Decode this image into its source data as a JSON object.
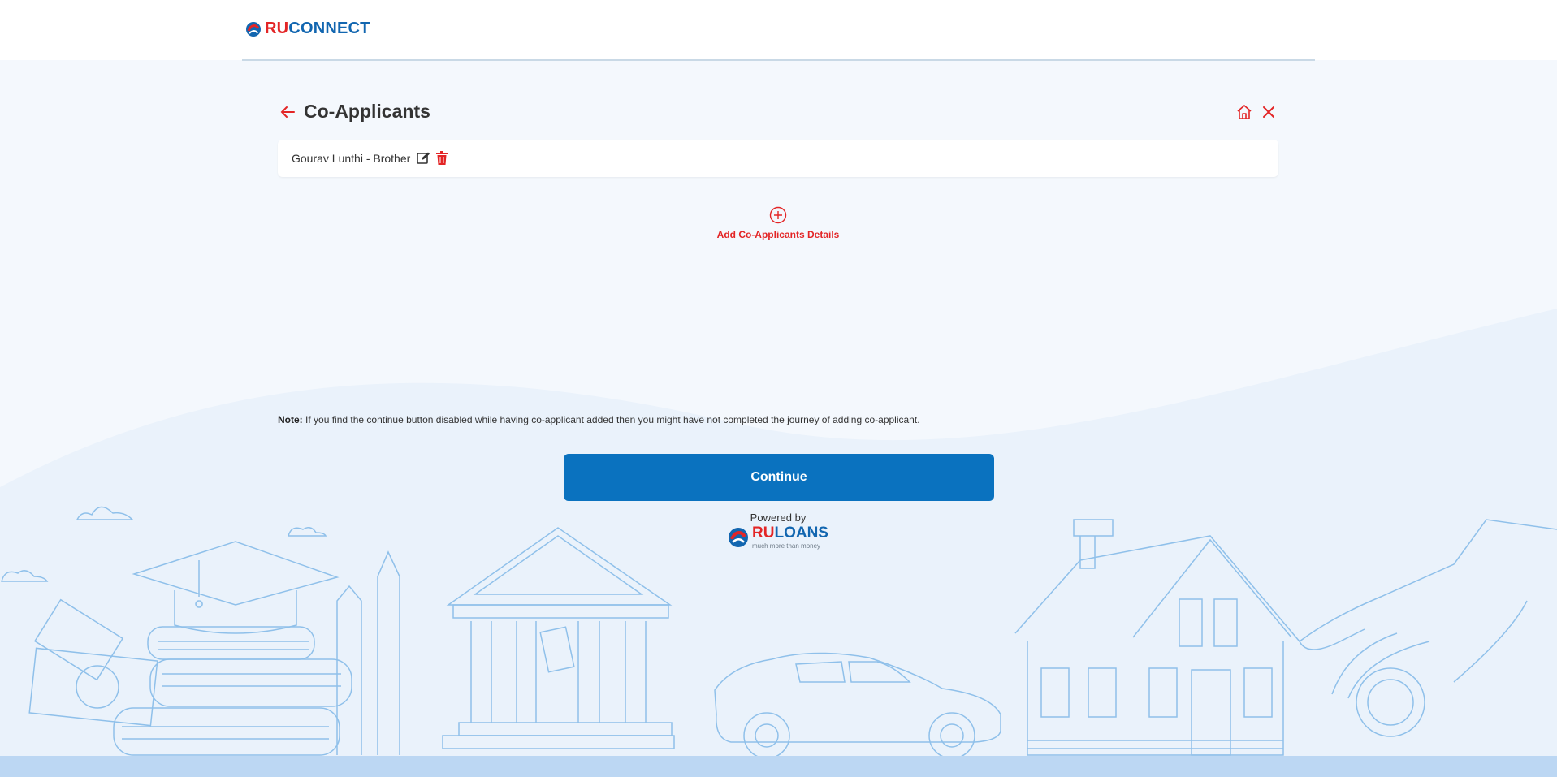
{
  "brand": {
    "logo_ru": "RU",
    "logo_connect": "CONNECT",
    "accent": "#e32526",
    "primary": "#0a72bf"
  },
  "header": {
    "back_icon": "arrow-left-icon",
    "title": "Co-Applicants",
    "home_icon": "home-icon",
    "close_icon": "close-icon"
  },
  "applicants": [
    {
      "label": "Gourav Lunthi - Brother",
      "edit_icon": "edit-icon",
      "delete_icon": "trash-icon"
    }
  ],
  "add": {
    "icon": "plus-circle-icon",
    "label": "Add Co-Applicants Details"
  },
  "note": {
    "label": "Note:",
    "text": "If you find the continue button disabled while having co-applicant added then you might have not completed the journey of adding co-applicant."
  },
  "continue_label": "Continue",
  "powered": {
    "label": "Powered by",
    "brand_ru": "RU",
    "brand_loans": "LOANS",
    "tagline": "much more than money"
  }
}
